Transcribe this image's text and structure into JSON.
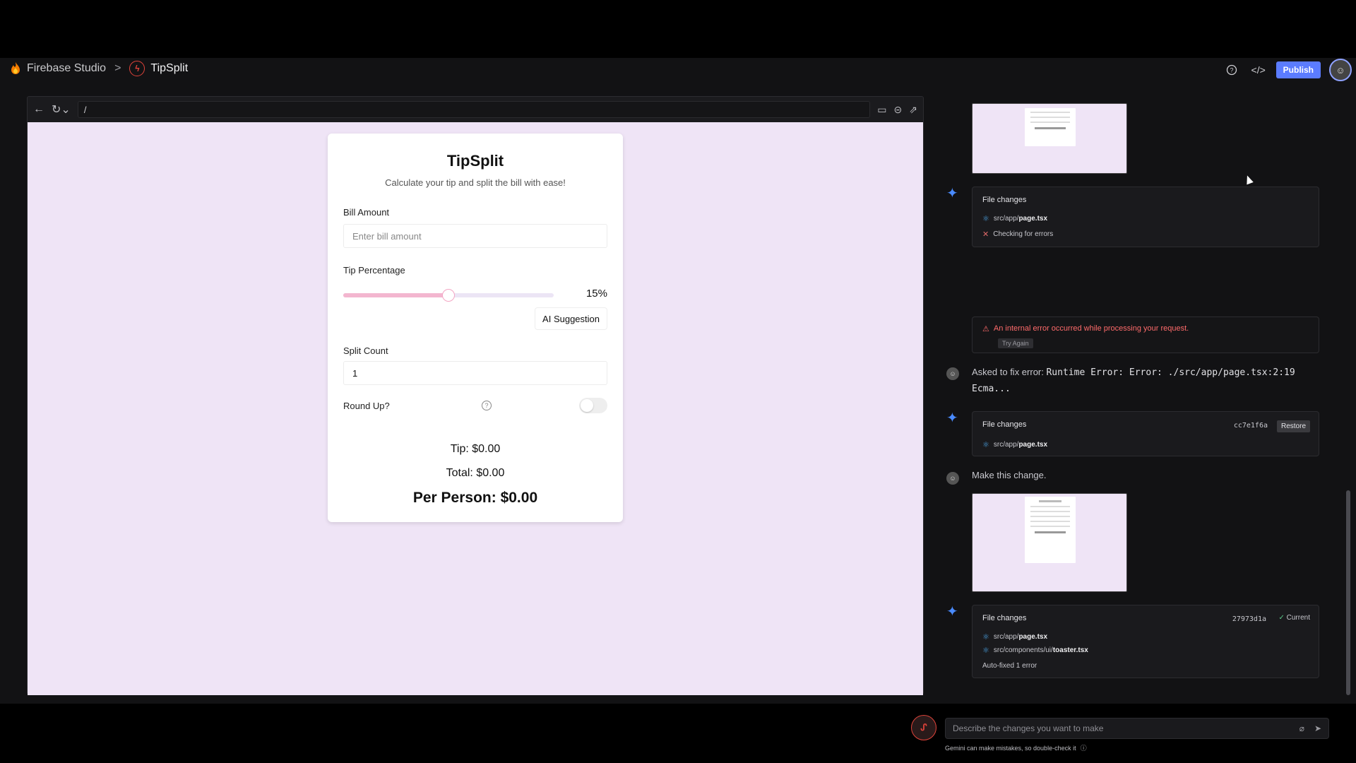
{
  "topbar": {
    "brand": "Firebase Studio",
    "separator": ">",
    "project": "TipSplit",
    "publish_label": "Publish",
    "help_icon": "help-circle-icon",
    "code_icon": "code-icon"
  },
  "preview": {
    "url": "/",
    "app": {
      "title": "TipSplit",
      "subtitle": "Calculate your tip and split the bill with ease!",
      "bill_label": "Bill Amount",
      "bill_placeholder": "Enter bill amount",
      "tip_label": "Tip Percentage",
      "tip_value": "15%",
      "tip_fraction": 0.5,
      "ai_button": "AI Suggestion",
      "split_label": "Split Count",
      "split_value": "1",
      "round_label": "Round Up?",
      "round_on": false,
      "tip_result": "Tip: $0.00",
      "total_result": "Total: $0.00",
      "per_person_result": "Per Person: $0.00"
    }
  },
  "chat": {
    "file_changes_1": {
      "title": "File changes",
      "file_prefix": "src/app/",
      "file_name": "page.tsx",
      "status": "Checking for errors"
    },
    "error": {
      "message": "An internal error occurred while processing your request.",
      "try_again": "Try Again"
    },
    "user_msg_1": {
      "prefix": "Asked to fix error: ",
      "code": "Runtime Error: Error: ./src/app/page.tsx:2:19",
      "code2": "Ecma..."
    },
    "file_changes_2": {
      "title": "File changes",
      "hash": "cc7e1f6a",
      "restore": "Restore",
      "file_prefix": "src/app/",
      "file_name": "page.tsx"
    },
    "user_msg_2": "Make this change.",
    "file_changes_3": {
      "title": "File changes",
      "hash": "27973d1a",
      "current": "Current",
      "file1_prefix": "src/app/",
      "file1_name": "page.tsx",
      "file2_prefix": "src/components/ui/",
      "file2_name": "toaster.tsx",
      "note": "Auto-fixed 1 error"
    }
  },
  "composer": {
    "placeholder": "Describe the changes you want to make",
    "disclaimer": "Gemini can make mistakes, so double-check it"
  },
  "colors": {
    "accent": "#5b7cff",
    "error": "#ff6b6b",
    "sparkle": "#4a8bff",
    "preview_bg": "#efe4f6"
  }
}
